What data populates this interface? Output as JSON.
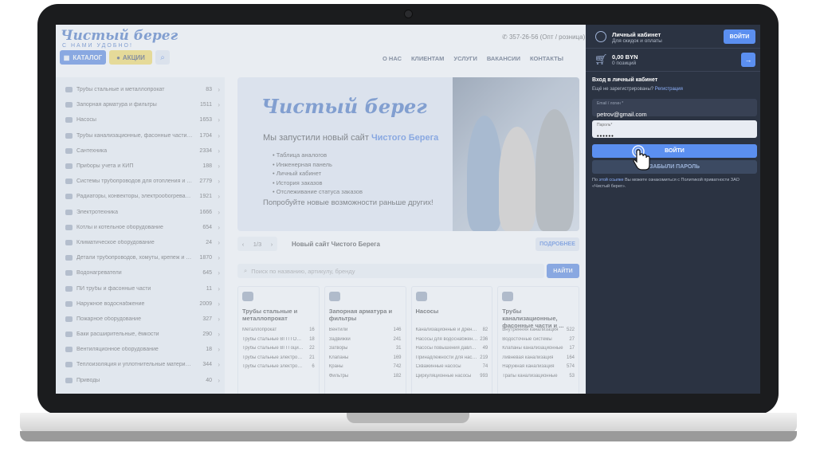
{
  "header": {
    "logo": "Чистый берег",
    "logo_tagline": "С НАМИ УДОБНО!",
    "catalog_label": "КАТАЛОГ",
    "promo_label": "АКЦИИ",
    "phone": "357-26-56 (Опт / розница)",
    "nav": [
      "О НАС",
      "КЛИЕНТАМ",
      "УСЛУГИ",
      "ВАКАНСИИ",
      "КОНТАКТЫ"
    ]
  },
  "sidebar": {
    "items": [
      {
        "label": "Трубы стальные и металлопрокат",
        "count": "83"
      },
      {
        "label": "Запорная арматура и фильтры",
        "count": "1511"
      },
      {
        "label": "Насосы",
        "count": "1653"
      },
      {
        "label": "Трубы канализационные, фасонные части и к...",
        "count": "1704"
      },
      {
        "label": "Сантехника",
        "count": "2334"
      },
      {
        "label": "Приборы учета и КИП",
        "count": "188"
      },
      {
        "label": "Системы трубопроводов для отопления и вод...",
        "count": "2779"
      },
      {
        "label": "Радиаторы, конвекторы, электрообогревател...",
        "count": "1921"
      },
      {
        "label": "Электротехника",
        "count": "1666"
      },
      {
        "label": "Котлы и котельное оборудование",
        "count": "654"
      },
      {
        "label": "Климатическое оборудование",
        "count": "24"
      },
      {
        "label": "Детали трубопроводов, хомуты, крепеж и фит...",
        "count": "1870"
      },
      {
        "label": "Водонагреватели",
        "count": "645"
      },
      {
        "label": "ПИ трубы и фасонные части",
        "count": "11"
      },
      {
        "label": "Наружное водоснабжение",
        "count": "2009"
      },
      {
        "label": "Пожарное оборудование",
        "count": "327"
      },
      {
        "label": "Баки расширительные, ёмкости",
        "count": "290"
      },
      {
        "label": "Вентиляционное оборудование",
        "count": "18"
      },
      {
        "label": "Теплоизоляция и уплотнительные материалы",
        "count": "344"
      },
      {
        "label": "Приводы",
        "count": "40"
      }
    ]
  },
  "banner": {
    "logo": "Чистый берег",
    "title_prefix": "Мы запустили новый сайт",
    "title_accent": "Чистого Берега",
    "features": [
      "Таблица аналогов",
      "Инженерная панель",
      "Личный кабинет",
      "История заказов",
      "Отслеживание статуса заказов"
    ],
    "cta": "Попробуйте новые возможности раньше других!"
  },
  "slider": {
    "position": "1/3",
    "title": "Новый сайт Чистого Берега",
    "more_label": "ПОДРОБНЕЕ"
  },
  "search": {
    "placeholder": "Поиск по названию, артикулу, бренду",
    "button": "НАЙТИ"
  },
  "cards": [
    {
      "title": "Трубы стальные и металлопрокат",
      "rows": [
        [
          "Металлопрокат",
          "16"
        ],
        [
          "Трубы стальные ВГП ГОСТ 3...",
          "18"
        ],
        [
          "Трубы стальные ВГП оцинко...",
          "22"
        ],
        [
          "Трубы стальные электросв...",
          "21"
        ],
        [
          "Трубы стальные электросв...",
          "6"
        ]
      ]
    },
    {
      "title": "Запорная арматура и фильтры",
      "rows": [
        [
          "Вентили",
          "146"
        ],
        [
          "Задвижки",
          "241"
        ],
        [
          "Затворы",
          "31"
        ],
        [
          "Клапаны",
          "169"
        ],
        [
          "Краны",
          "742"
        ],
        [
          "Фильтры",
          "182"
        ]
      ]
    },
    {
      "title": "Насосы",
      "rows": [
        [
          "Канализационные и дренаж...",
          "82"
        ],
        [
          "Насосы для водоснабжения",
          "236"
        ],
        [
          "Насосы повышения давлени...",
          "49"
        ],
        [
          "Принадлежности для насос...",
          "219"
        ],
        [
          "Скважинные насосы",
          "74"
        ],
        [
          "Циркуляционные насосы",
          "993"
        ]
      ]
    },
    {
      "title": "Трубы канализационные, фасонные части и ...",
      "rows": [
        [
          "Внутренняя канализация",
          "522"
        ],
        [
          "Водосточные системы",
          "27"
        ],
        [
          "Клапаны канализационные",
          "17"
        ],
        [
          "Ливневая канализация",
          "164"
        ],
        [
          "Наружная канализация",
          "574"
        ],
        [
          "Трапы канализационные",
          "53"
        ]
      ]
    }
  ],
  "panel": {
    "account_title": "Личный кабинет",
    "account_sub": "Для скидок и оплаты",
    "login_button": "ВОЙТИ",
    "cart_sum": "0,00 BYN",
    "cart_count": "0 позиций",
    "cart_arrow": "→",
    "login_heading": "Вход в личный кабинет",
    "not_registered": "Ещё не зарегистрированы?",
    "register_link": "Регистрация",
    "email_label": "Email / логин *",
    "email_value": "petrov@gmail.com",
    "password_label": "Пароль*",
    "password_value": "••••••",
    "submit_label": "ВОЙТИ",
    "forgot_label": "ЗАБЫЛИ ПАРОЛЬ",
    "privacy_prefix": "По",
    "privacy_link": "этой ссылке",
    "privacy_suffix": "Вы можете ознакомиться с Политикой приватности ЗАО «Чистый берег»."
  }
}
